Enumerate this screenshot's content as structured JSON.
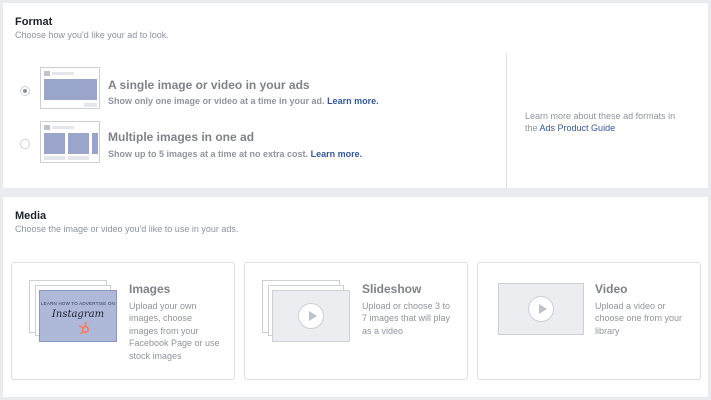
{
  "format": {
    "title": "Format",
    "subtitle": "Choose how you'd like your ad to look.",
    "options": [
      {
        "title": "A single image or video in your ads",
        "description": "Show only one image or video at a time in your ad.",
        "link": "Learn more.",
        "selected": true
      },
      {
        "title": "Multiple images in one ad",
        "description": "Show up to 5 images at a time at no extra cost.",
        "link": "Learn more.",
        "selected": false
      }
    ],
    "help_text": "Learn more about these ad formats in the",
    "help_link": "Ads Product Guide"
  },
  "media": {
    "title": "Media",
    "subtitle": "Choose the image or video you'd like to use in your ads.",
    "cards": [
      {
        "title": "Images",
        "description": "Upload your own images, choose images from your Facebook Page or use stock images",
        "thumb_small_text": "LEARN HOW TO ADVERTISE ON",
        "thumb_big_text": "Instagram"
      },
      {
        "title": "Slideshow",
        "description": "Upload or choose 3 to 7 images that will play as a video"
      },
      {
        "title": "Video",
        "description": "Upload a video or choose one from your library"
      }
    ]
  },
  "colors": {
    "link": "#365899",
    "panel_bg": "#ffffff",
    "page_bg": "#e9ebee",
    "accent_hubspot": "#ff7a59"
  }
}
